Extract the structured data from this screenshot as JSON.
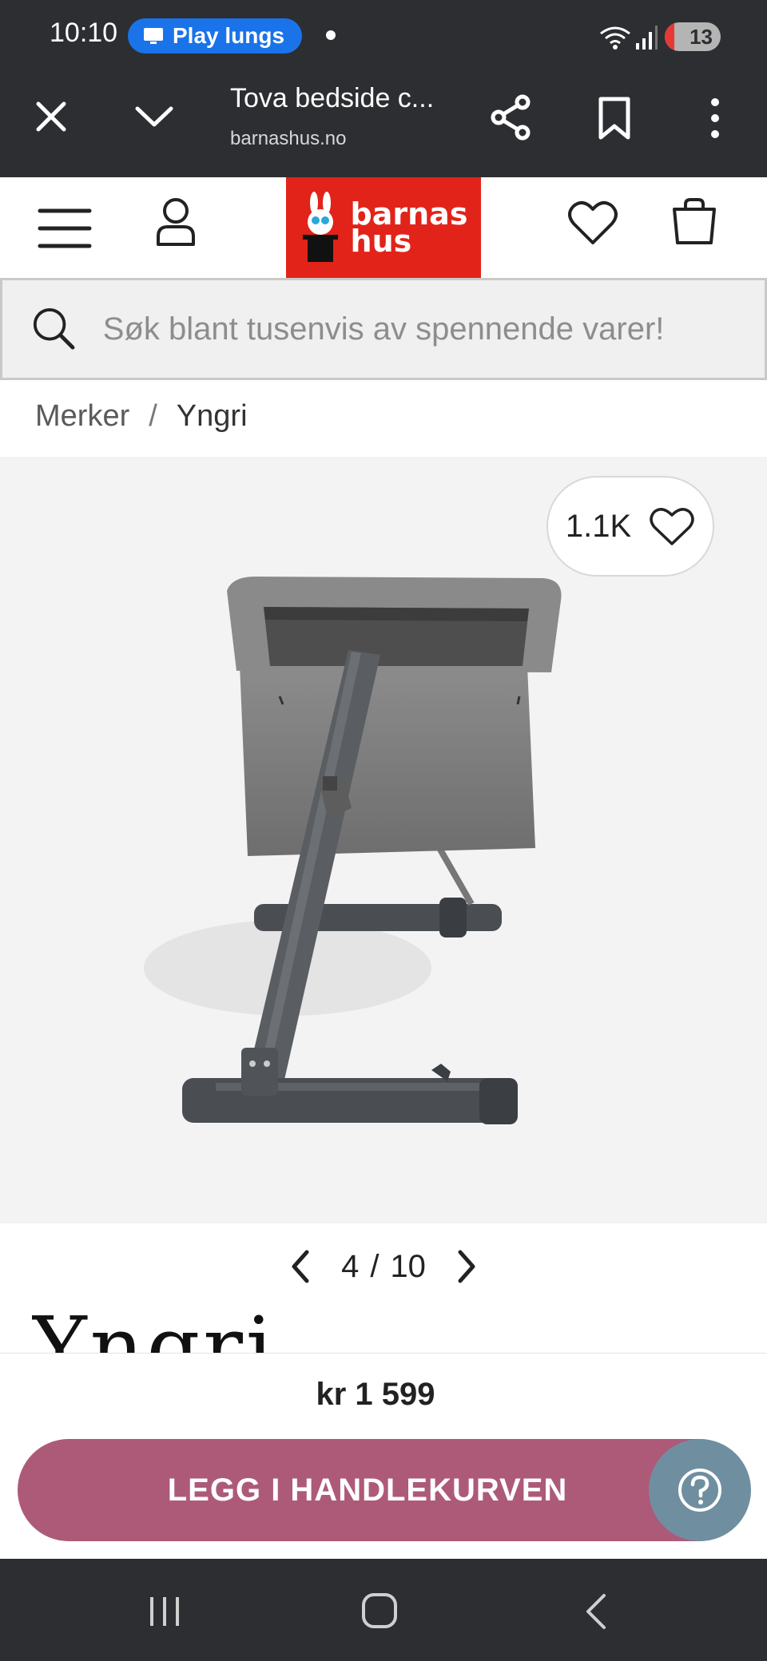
{
  "status_bar": {
    "time": "10:10",
    "notification": "Play lungs",
    "battery": "13"
  },
  "custom_tab": {
    "title": "Tova bedside c...",
    "url": "barnashus.no"
  },
  "site": {
    "logo_line1": "barnas",
    "logo_line2": "hus",
    "brand_color": "#e2231a"
  },
  "search": {
    "placeholder": "Søk blant tusenvis av spennende varer!"
  },
  "breadcrumb": {
    "items": [
      "Merker",
      "Yngri"
    ],
    "separator": "/"
  },
  "product": {
    "likes": "1.1K",
    "image_index": "4",
    "image_sep": "/",
    "image_total": "10",
    "brand_word": "Yngri",
    "price": "kr 1 599",
    "add_to_cart_label": "LEGG I HANDLEKURVEN",
    "cart_button_color": "#ad5a78",
    "help_button_color": "#6f8fa1"
  }
}
